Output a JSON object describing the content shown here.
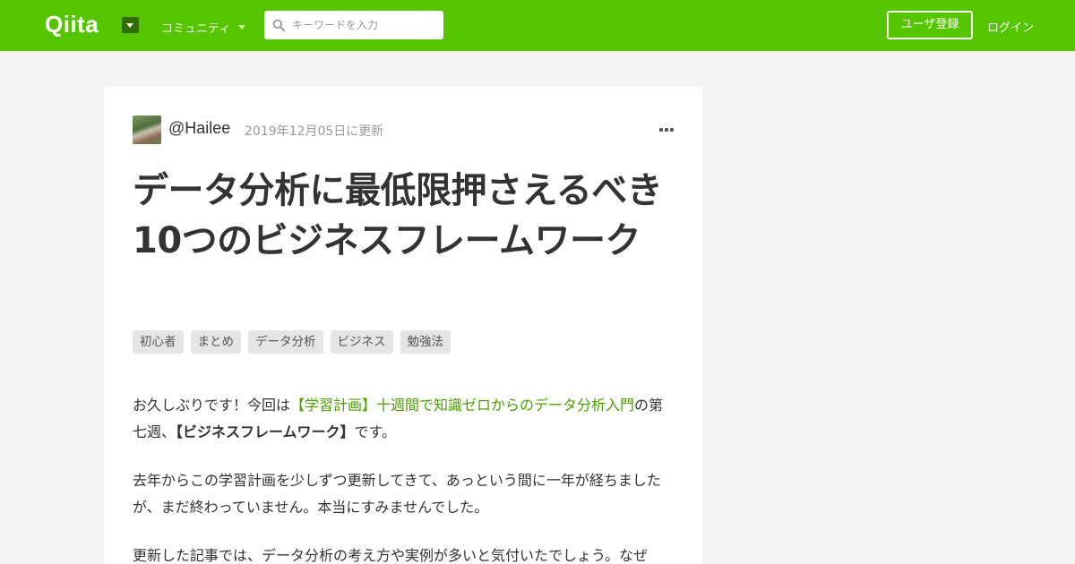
{
  "header": {
    "logo_text": "Qiita",
    "community_label": "コミュニティ",
    "search_placeholder": "キーワードを入力",
    "signup_label": "ユーザ登録",
    "login_label": "ログイン",
    "colors": {
      "brand": "#55c500",
      "link": "#4aa000"
    }
  },
  "article": {
    "author": "@Hailee",
    "updated": "2019年12月05日に更新",
    "title": "データ分析に最低限押さえるべき10つのビジネスフレームワーク",
    "tags": [
      "初心者",
      "まとめ",
      "データ分析",
      "ビジネス",
      "勉強法"
    ],
    "paragraph1": {
      "before": "お久しぶりです！今回は",
      "link": "【学習計画】十週間で知識ゼロからのデータ分析入門",
      "middle": "の第七週、",
      "bold": "【ビジネスフレームワーク】",
      "after": "です。"
    },
    "paragraph2": "去年からこの学習計画を少しずつ更新してきて、あっという間に一年が経ちましたが、まだ終わっていません。本当にすみませんでした。",
    "paragraph3": "更新した記事では、データ分析の考え方や実例が多いと気付いたでしょう。なぜ"
  }
}
